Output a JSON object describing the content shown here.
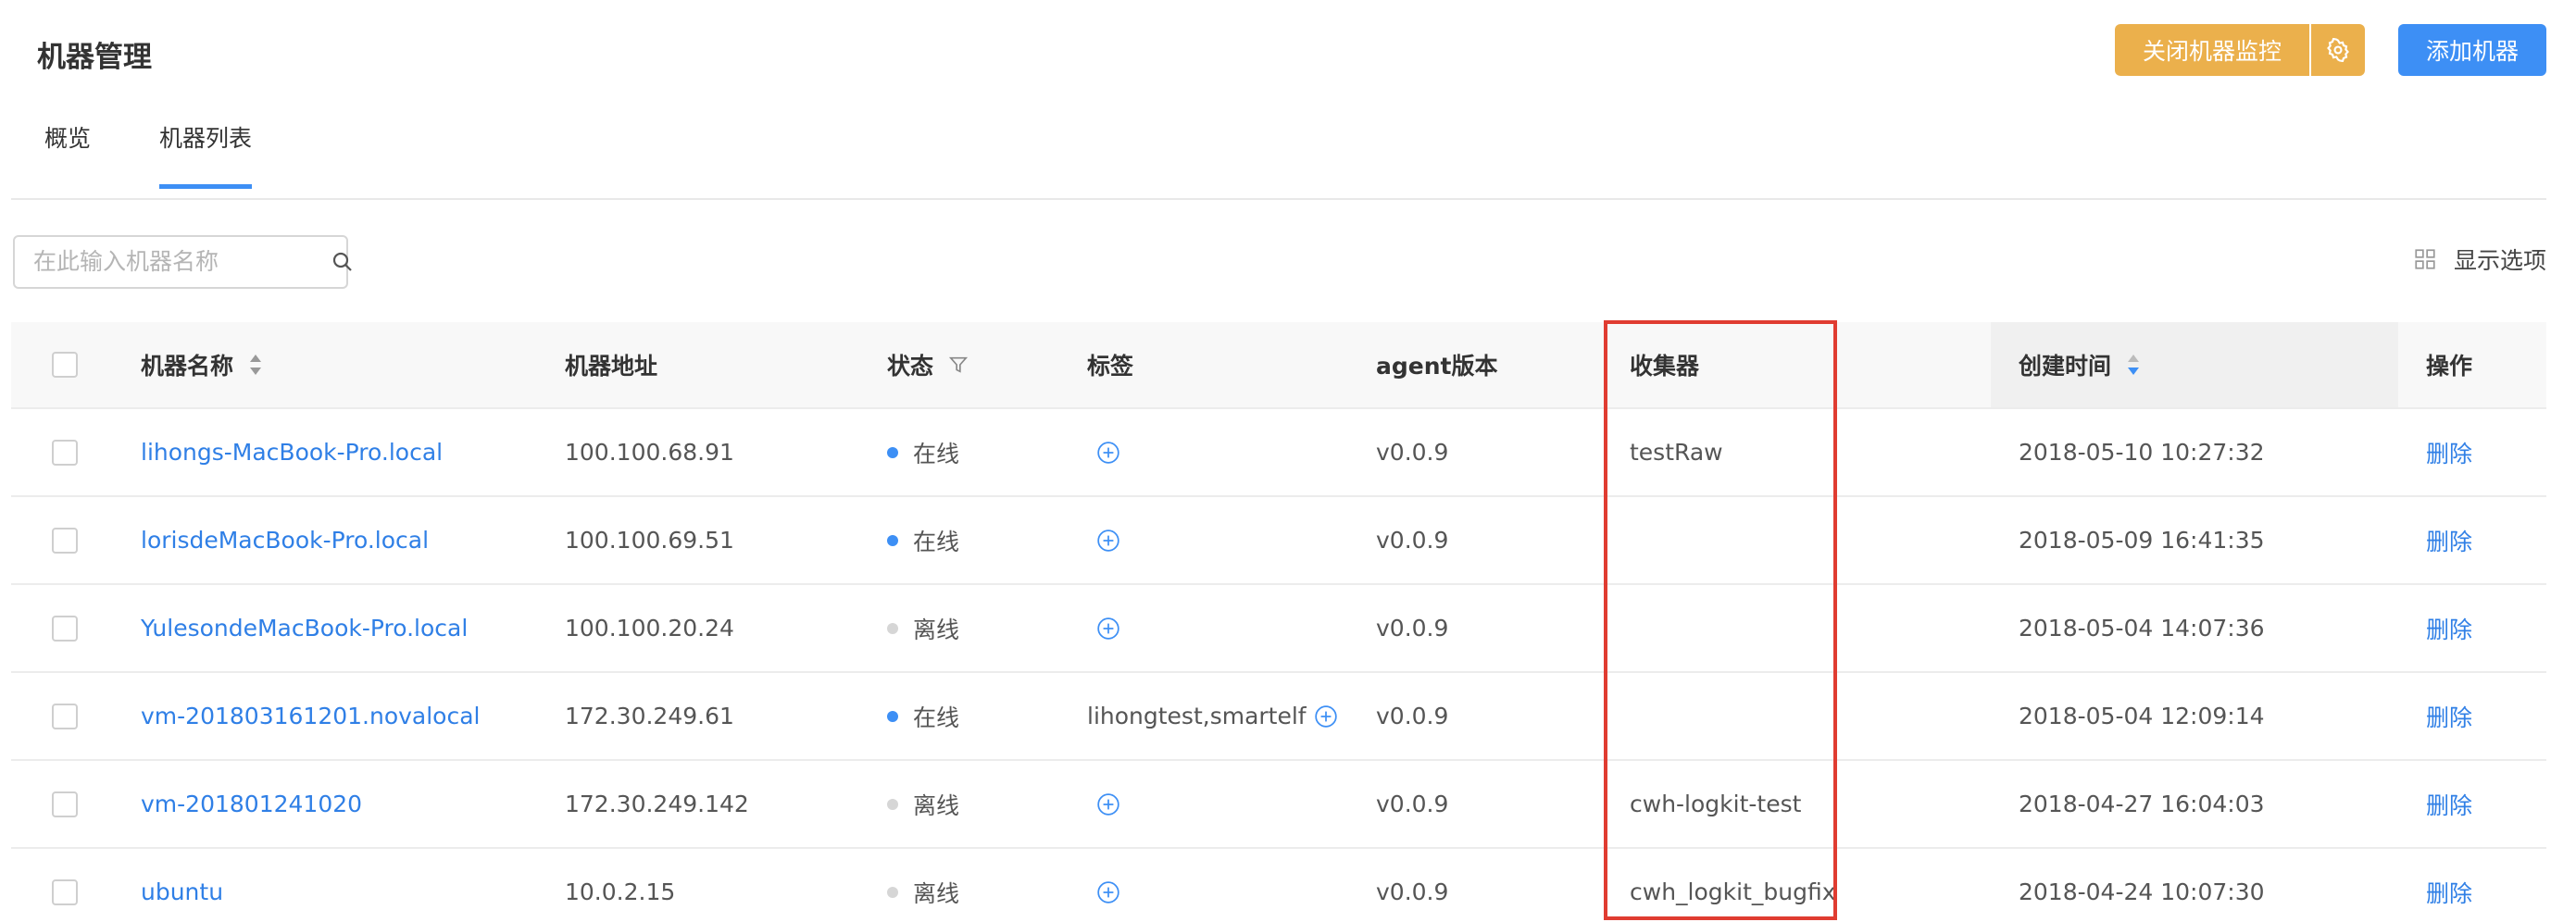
{
  "page": {
    "title": "机器管理"
  },
  "top_actions": {
    "close_monitor_label": "关闭机器监控",
    "gear_icon": "gear-icon",
    "add_machine_label": "添加机器",
    "warn_color": "#ebb04c",
    "primary_color": "#3d8ff5"
  },
  "tabs": [
    {
      "label": "概览",
      "active": false
    },
    {
      "label": "机器列表",
      "active": true
    }
  ],
  "search": {
    "placeholder": "在此输入机器名称",
    "value": ""
  },
  "display_options": {
    "label": "显示选项",
    "icon": "grid-icon"
  },
  "table": {
    "columns": {
      "name": "机器名称",
      "address": "机器地址",
      "status": "状态",
      "tags": "标签",
      "agent": "agent版本",
      "collector": "收集器",
      "created": "创建时间",
      "actions": "操作"
    },
    "rows": [
      {
        "name": "lihongs-MacBook-Pro.local",
        "address": "100.100.68.91",
        "status": "在线",
        "online": true,
        "tags": "",
        "agent": "v0.0.9",
        "collector": "testRaw",
        "created": "2018-05-10 10:27:32",
        "action": "删除"
      },
      {
        "name": "lorisdeMacBook-Pro.local",
        "address": "100.100.69.51",
        "status": "在线",
        "online": true,
        "tags": "",
        "agent": "v0.0.9",
        "collector": "",
        "created": "2018-05-09 16:41:35",
        "action": "删除"
      },
      {
        "name": "YulesondeMacBook-Pro.local",
        "address": "100.100.20.24",
        "status": "离线",
        "online": false,
        "tags": "",
        "agent": "v0.0.9",
        "collector": "",
        "created": "2018-05-04 14:07:36",
        "action": "删除"
      },
      {
        "name": "vm-201803161201.novalocal",
        "address": "172.30.249.61",
        "status": "在线",
        "online": true,
        "tags": "lihongtest,smartelf",
        "agent": "v0.0.9",
        "collector": "",
        "created": "2018-05-04 12:09:14",
        "action": "删除"
      },
      {
        "name": "vm-201801241020",
        "address": "172.30.249.142",
        "status": "离线",
        "online": false,
        "tags": "",
        "agent": "v0.0.9",
        "collector": "cwh-logkit-test",
        "created": "2018-04-27 16:04:03",
        "action": "删除"
      },
      {
        "name": "ubuntu",
        "address": "10.0.2.15",
        "status": "离线",
        "online": false,
        "tags": "",
        "agent": "v0.0.9",
        "collector": "cwh_logkit_bugfix",
        "created": "2018-04-24 10:07:30",
        "action": "删除"
      }
    ]
  },
  "colors": {
    "link": "#2f7fe6",
    "online": "#3d8ff5",
    "offline": "#d6d6d6",
    "highlight": "#e03c31"
  }
}
